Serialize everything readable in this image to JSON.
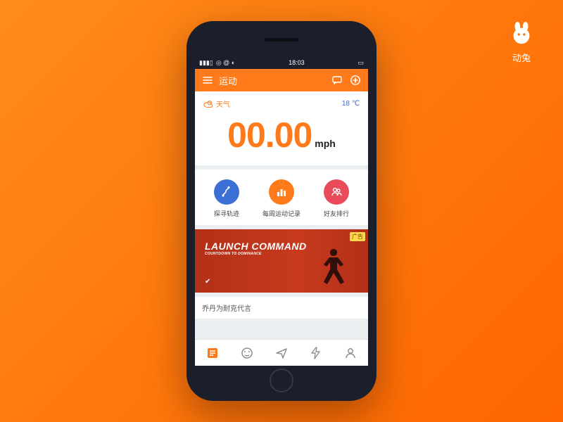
{
  "logo": {
    "label": "动兔"
  },
  "status": {
    "time": "18:03",
    "signal": "▮▮▮▯",
    "carrier_icons": "◎ @ ◐"
  },
  "header": {
    "title": "运动",
    "menu_icon": "menu-icon",
    "chat_icon": "chat-icon",
    "add_icon": "add-icon"
  },
  "weather": {
    "label": "天气",
    "temp": "18 ℃"
  },
  "speed": {
    "value": "00.00",
    "unit": "mph"
  },
  "actions": [
    {
      "label": "探寻轨迹",
      "color": "blue"
    },
    {
      "label": "每周运动记录",
      "color": "orange"
    },
    {
      "label": "好友排行",
      "color": "red"
    }
  ],
  "promo": {
    "headline": "LAUNCH COMMAND",
    "subline": "COUNTDOWN TO DOMINANCE",
    "badge": "广告"
  },
  "caption": "乔丹为耐克代言",
  "tabs": [
    "home",
    "discover",
    "navigate",
    "power",
    "profile"
  ]
}
